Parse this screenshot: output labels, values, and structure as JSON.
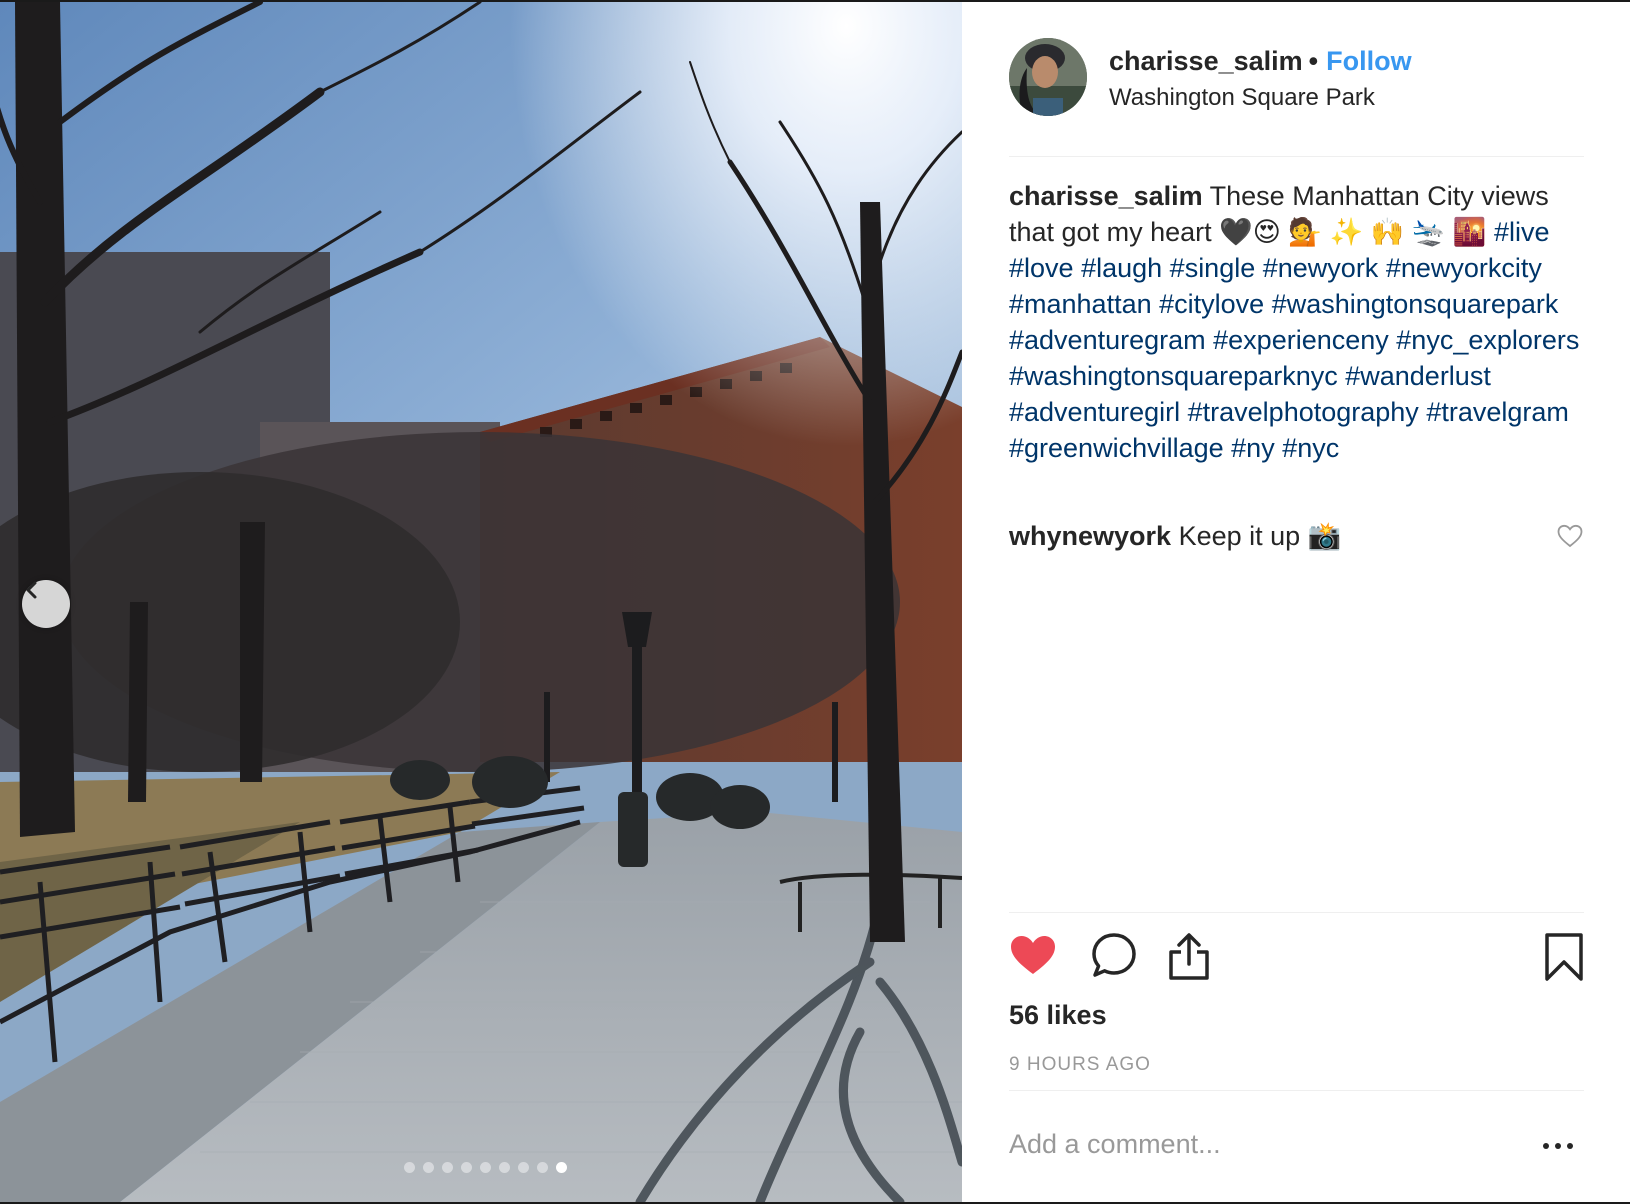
{
  "post": {
    "username": "charisse_salim",
    "separator": "•",
    "follow_label": "Follow",
    "location": "Washington Square Park"
  },
  "caption": {
    "username": "charisse_salim",
    "text": "These Manhattan City views that got my heart 🖤😍 💁 ✨ 🙌 🛬 🌇",
    "hashtags": [
      "#live",
      "#love",
      "#laugh",
      "#single",
      "#newyork",
      "#newyorkcity",
      "#manhattan",
      "#citylove",
      "#washingtonsquarepark",
      "#adventuregram",
      "#experienceny",
      "#nyc_explorers",
      "#washingtonsquareparknyc",
      "#wanderlust",
      "#adventuregirl",
      "#travelphotography",
      "#travelgram",
      "#greenwichvillage",
      "#ny",
      "#nyc"
    ]
  },
  "comments": [
    {
      "username": "whynewyork",
      "text": "Keep it up 📸"
    }
  ],
  "icons": {
    "like": "heart-filled-icon",
    "comment": "comment-bubble-icon",
    "share": "share-icon",
    "save": "bookmark-icon",
    "carousel_prev": "chevron-left-icon",
    "more": "more-options-icon"
  },
  "colors": {
    "like_red": "#ed4956",
    "follow_blue": "#3897f0",
    "hashtag_blue": "#003569",
    "muted_gray": "#999999"
  },
  "likes_text": "56 likes",
  "time_ago": "9 HOURS AGO",
  "add_comment_placeholder": "Add a comment...",
  "carousel": {
    "total": 9,
    "active_index": 9
  }
}
